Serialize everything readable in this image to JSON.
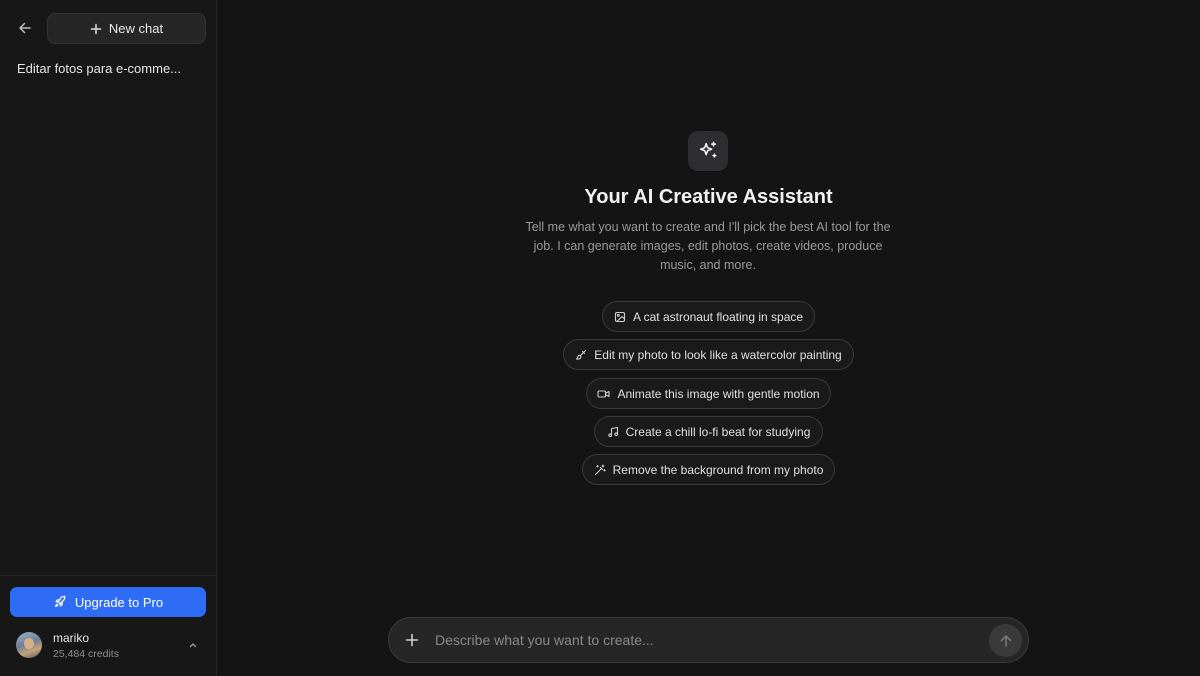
{
  "sidebar": {
    "new_chat_label": "New chat",
    "chats": [
      "Editar fotos para e-comme..."
    ],
    "upgrade_label": "Upgrade to Pro",
    "user": {
      "name": "mariko",
      "credits": "25,484 credits"
    }
  },
  "main": {
    "title": "Your AI Creative Assistant",
    "subtitle": "Tell me what you want to create and I'll pick the best AI tool for the job. I can generate images, edit photos, create videos, produce music, and more.",
    "suggestions": [
      {
        "label": "A cat astronaut floating in space",
        "icon": "image-icon"
      },
      {
        "label": "Edit my photo to look like a watercolor painting",
        "icon": "brush-icon"
      },
      {
        "label": "Animate this image with gentle motion",
        "icon": "video-icon"
      },
      {
        "label": "Create a chill lo-fi beat for studying",
        "icon": "music-icon"
      },
      {
        "label": "Remove the background from my photo",
        "icon": "magic-wand-icon"
      }
    ],
    "composer": {
      "placeholder": "Describe what you want to create..."
    }
  },
  "colors": {
    "accent": "#2f6cf5",
    "background": "#141414",
    "sidebar": "#171717"
  }
}
